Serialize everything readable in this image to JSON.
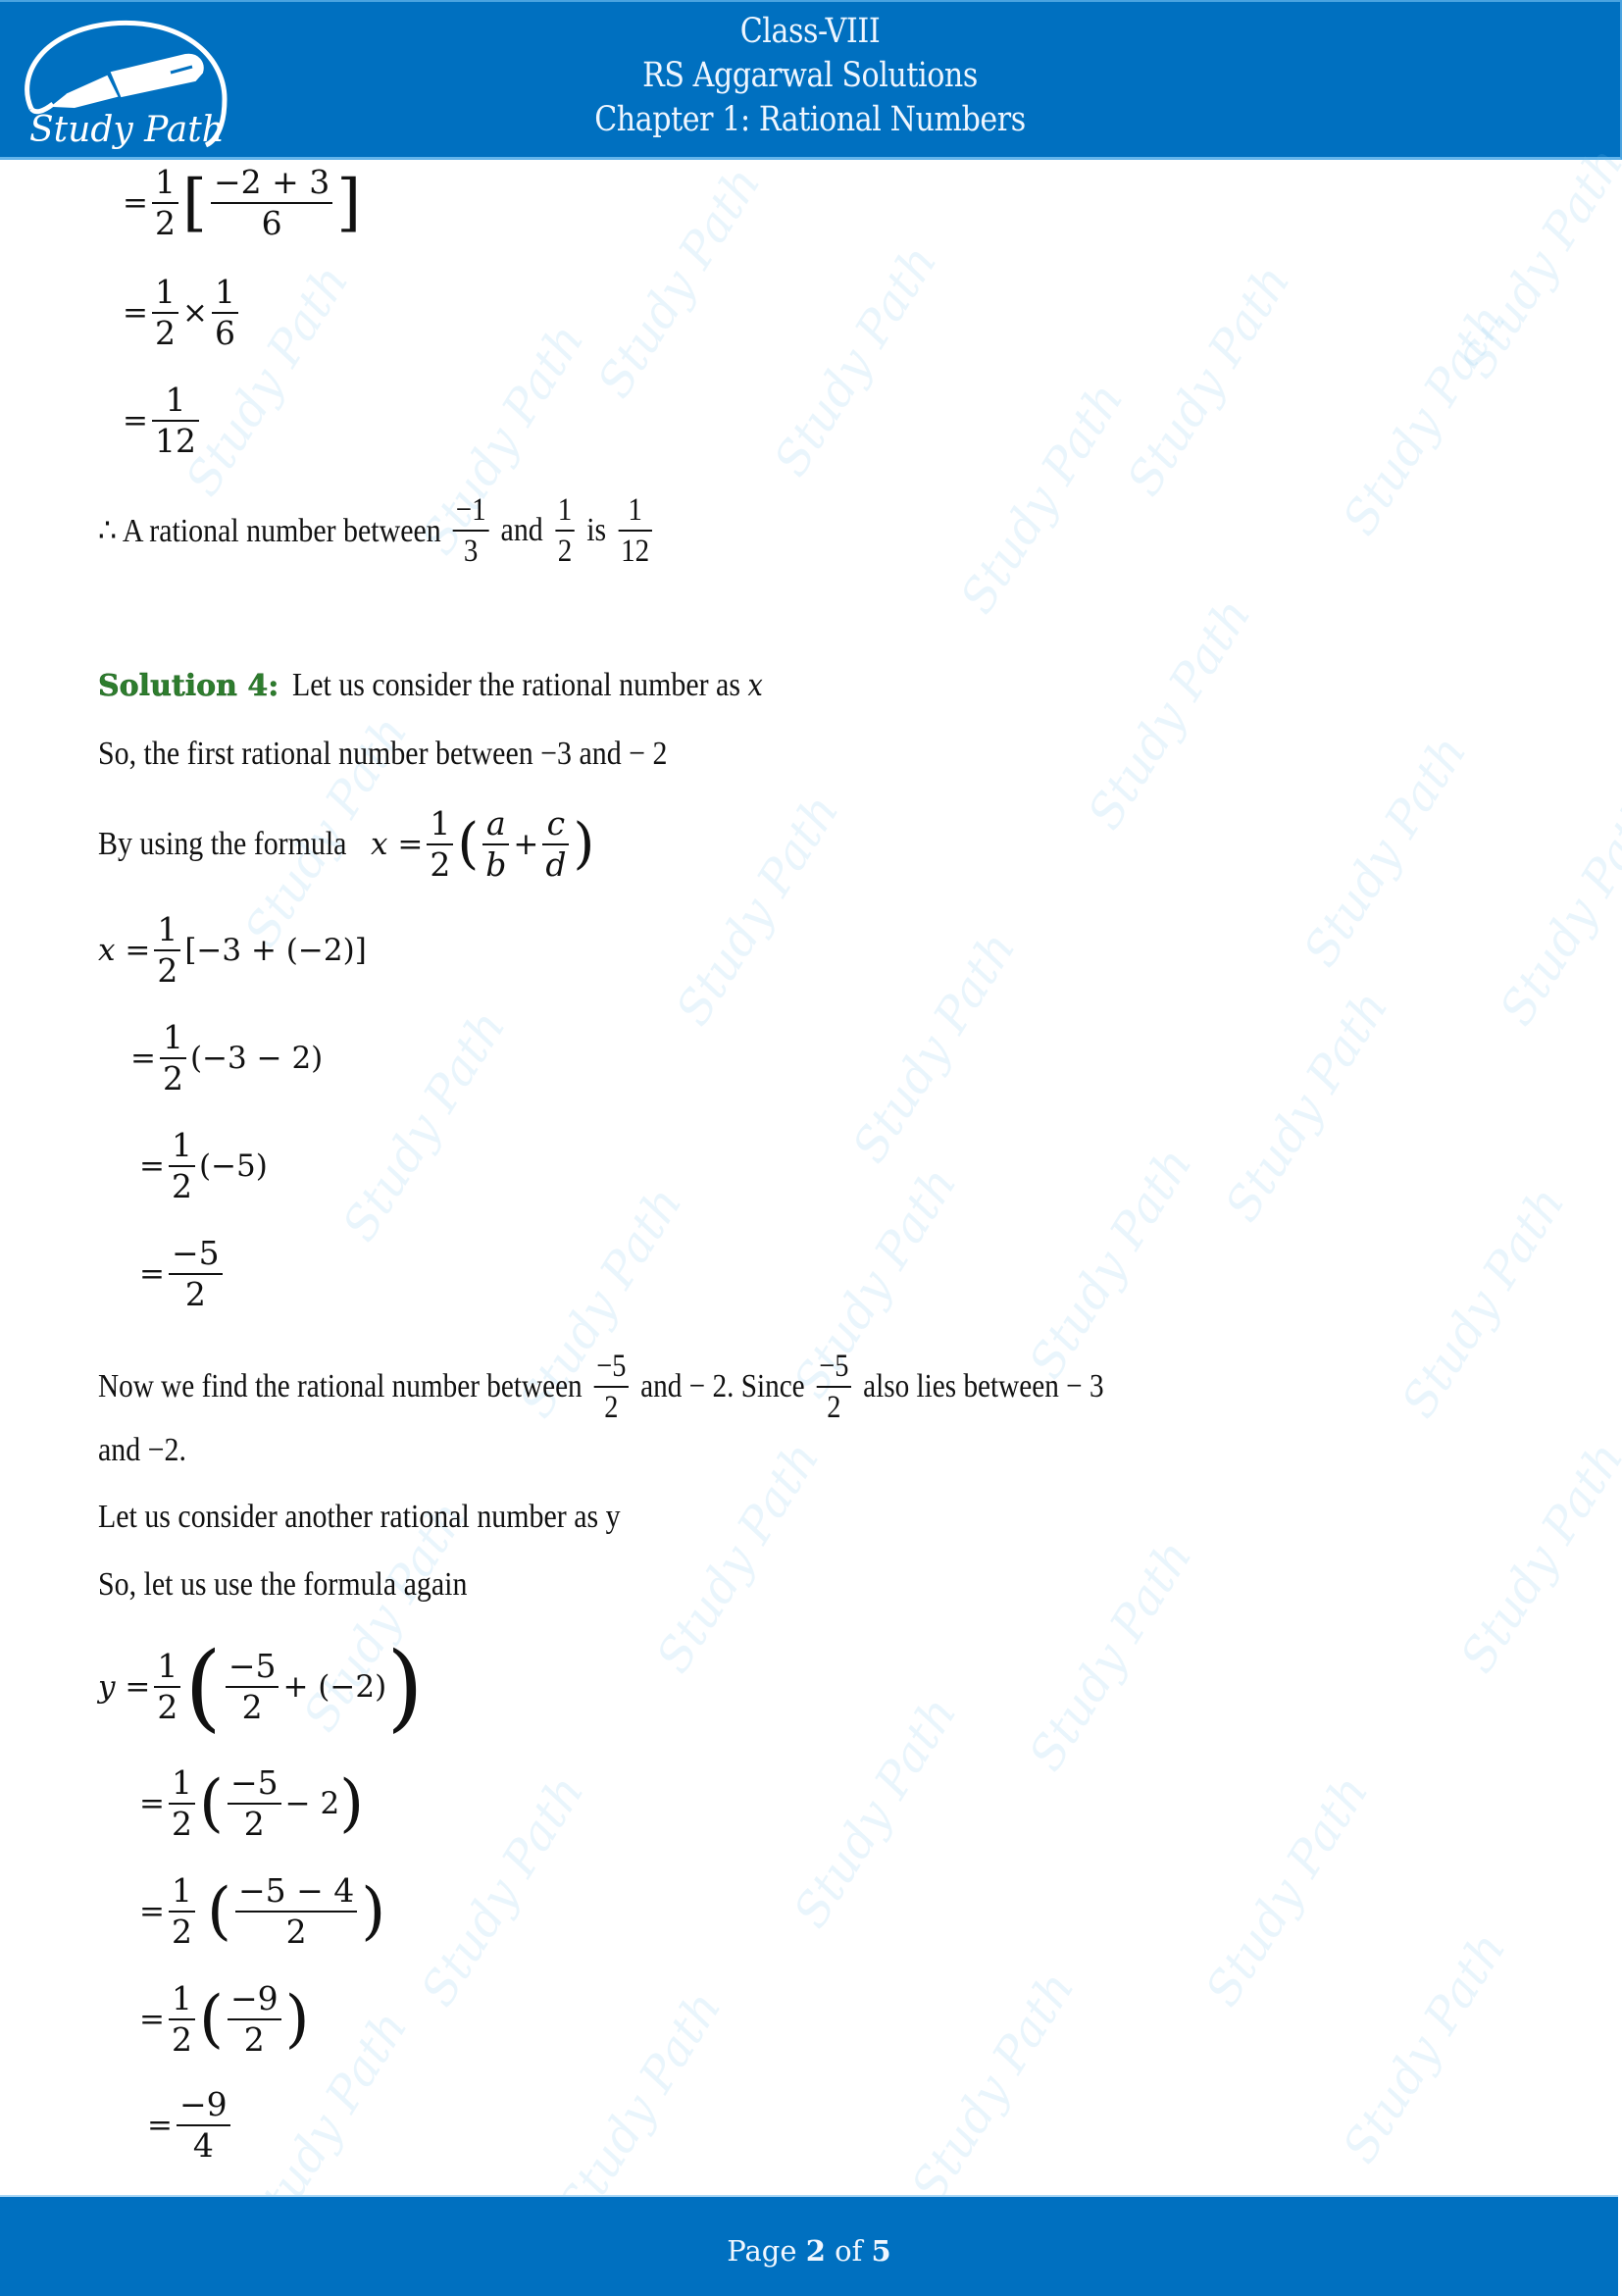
{
  "header": {
    "brand": "Study Path",
    "class_label": "Class-VIII",
    "book_label": "RS Aggarwal Solutions",
    "chapter_label": "Chapter 1: Rational Numbers",
    "background_color": "#0070c0"
  },
  "watermark_text": "Study Path",
  "continued_steps": {
    "step1": {
      "eq": "=",
      "coef_num": "1",
      "coef_den": "2",
      "open": "[",
      "inner_num": "−2 + 3",
      "inner_den": "6",
      "close": "]"
    },
    "step2": {
      "eq": "=",
      "a_num": "1",
      "a_den": "2",
      "op": "×",
      "b_num": "1",
      "b_den": "6"
    },
    "step3": {
      "eq": "=",
      "num": "1",
      "den": "12"
    },
    "conclusion": {
      "prefix": "∴ A rational number between",
      "f1_num": "−1",
      "f1_den": "3",
      "and": "and",
      "f2_num": "1",
      "f2_den": "2",
      "is": "is",
      "f3_num": "1",
      "f3_den": "12"
    }
  },
  "solution4": {
    "label": "Solution 4:",
    "label_color": "#2e7d2e",
    "intro": "Let us consider the rational number as",
    "intro_var": "x",
    "line2": "So, the first rational number between −3 and  − 2",
    "formula_prefix": "By using the formula",
    "formula": {
      "lhs": "x",
      "eq": "=",
      "c_num": "1",
      "c_den": "2",
      "a": "a",
      "b": "b",
      "plus": "+",
      "c": "c",
      "d": "d"
    },
    "x_steps": [
      {
        "lhs": "x",
        "eq": "=",
        "coef_num": "1",
        "coef_den": "2",
        "body": "[−3 + (−2)]"
      },
      {
        "eq": "=",
        "coef_num": "1",
        "coef_den": "2",
        "body": "(−3 − 2)"
      },
      {
        "eq": "=",
        "coef_num": "1",
        "coef_den": "2",
        "body": "(−5)"
      },
      {
        "eq": "=",
        "num": "−5",
        "den": "2"
      }
    ],
    "now_line": {
      "p1": "Now we find the rational number between",
      "f1_num": "−5",
      "f1_den": "2",
      "p2": "and  − 2. Since",
      "f2_num": "−5",
      "f2_den": "2",
      "p3": "also lies between  − 3"
    },
    "now_line_cont": "and −2.",
    "another_line": "Let us consider another rational number as y",
    "again_line": "So, let us use the formula again",
    "y_steps": [
      {
        "lhs": "y",
        "eq": "=",
        "coef_num": "1",
        "coef_den": "2",
        "in_num": "−5",
        "in_den": "2",
        "tail": "+ (−2)"
      },
      {
        "eq": "=",
        "coef_num": "1",
        "coef_den": "2",
        "in_num": "−5",
        "in_den": "2",
        "tail": "− 2"
      },
      {
        "eq": "=",
        "coef_num": "1",
        "coef_den": "2",
        "in_num": "−5 − 4",
        "in_den": "2",
        "tail": ""
      },
      {
        "eq": "=",
        "coef_num": "1",
        "coef_den": "2",
        "in_num": "−9",
        "in_den": "2",
        "tail": ""
      },
      {
        "eq": "=",
        "num": "−9",
        "den": "4"
      }
    ]
  },
  "footer": {
    "page_word": "Page",
    "current_page": "2",
    "of_word": "of",
    "total_pages": "5"
  }
}
